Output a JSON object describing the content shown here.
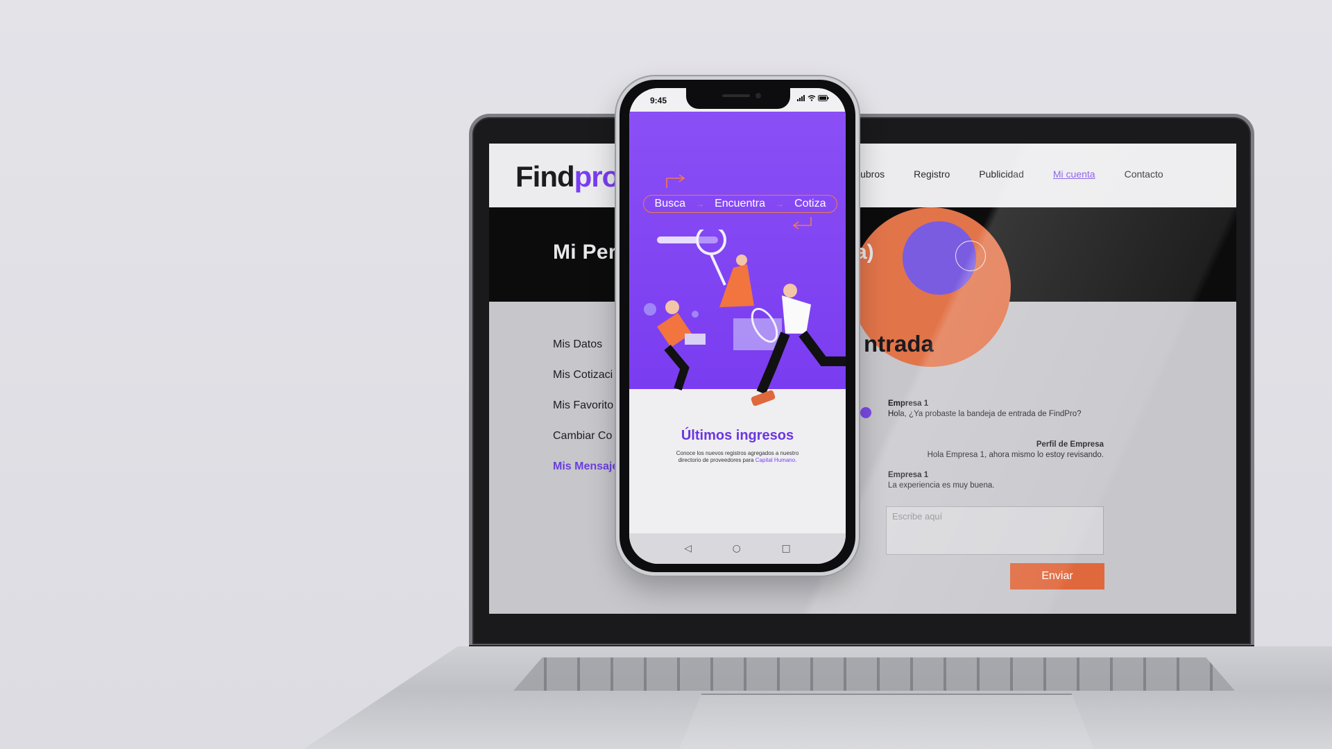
{
  "laptop": {
    "logo": {
      "part1": "Find",
      "part2": "pro"
    },
    "nav": [
      {
        "label": "Rubros"
      },
      {
        "label": "Registro"
      },
      {
        "label": "Publicidad"
      },
      {
        "label": "Mi cuenta"
      },
      {
        "label": "Contacto"
      }
    ],
    "hero": {
      "title_left": "Mi Per",
      "title_right": "a)"
    },
    "side_menu": [
      {
        "label": "Mis Datos"
      },
      {
        "label": "Mis Cotizaci"
      },
      {
        "label": "Mis Favorito"
      },
      {
        "label": "Cambiar Co"
      },
      {
        "label": "Mis Mensaje"
      }
    ],
    "inbox": {
      "title": "ntrada",
      "messages": [
        {
          "from": "Empresa 1",
          "text": "Hola, ¿Ya probaste la bandeja de entrada de FindPro?"
        },
        {
          "from": "Perfil de Empresa",
          "text": "Hola Empresa 1, ahora mismo lo estoy revisando."
        },
        {
          "from": "Empresa 1",
          "text": "La experiencia es muy buena."
        }
      ],
      "input_placeholder": "Escribe aquí",
      "send_label": "Enviar"
    },
    "colors": {
      "brand_purple": "#7a3df0",
      "accent_orange": "#e0683d"
    }
  },
  "phone": {
    "time": "9:45",
    "tagline": [
      "Busca",
      "Encuentra",
      "Cotiza"
    ],
    "section_title": "Últimos ingresos",
    "section_text_1": "Conoce los nuevos registros agregados a nuestro directorio de proveedores para ",
    "section_text_highlight": "Capital Humano.",
    "nav_icons": [
      "back-icon",
      "home-icon",
      "recents-icon"
    ]
  }
}
